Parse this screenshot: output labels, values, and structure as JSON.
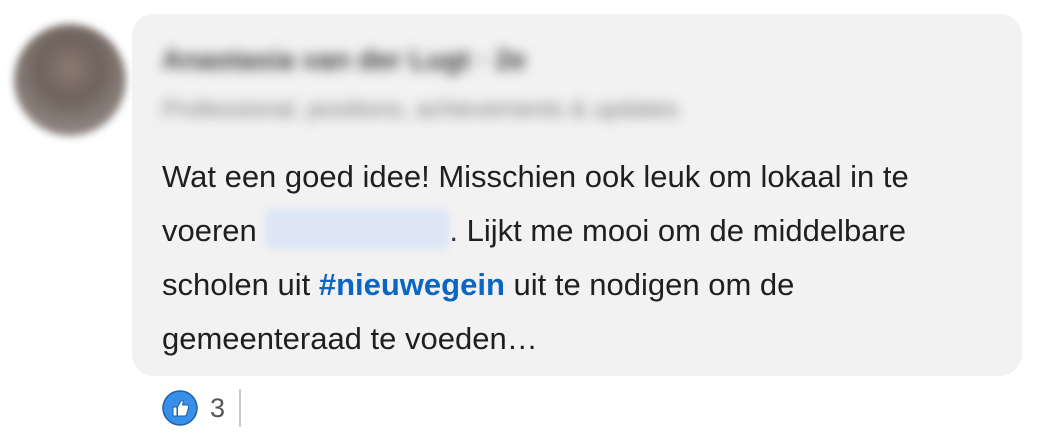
{
  "comment": {
    "author_name": "Anastasia van der Lugt · 2e",
    "author_headline": "Professional, positions, achievements & updates",
    "text_before_mention": "Wat een goed idee! Misschien ook leuk om lokaal in te voeren ",
    "text_after_mention": ". Lijkt me mooi om de middelbare scholen uit ",
    "hashtag": "#nieuwegein",
    "text_after_hashtag": " uit te nodigen om de gemeenteraad te voeden…"
  },
  "reactions": {
    "icon": "like-icon",
    "count": "3"
  },
  "colors": {
    "bubble": "#f2f2f2",
    "hashtag": "#0a66c2",
    "like_icon": "#378fe9"
  }
}
